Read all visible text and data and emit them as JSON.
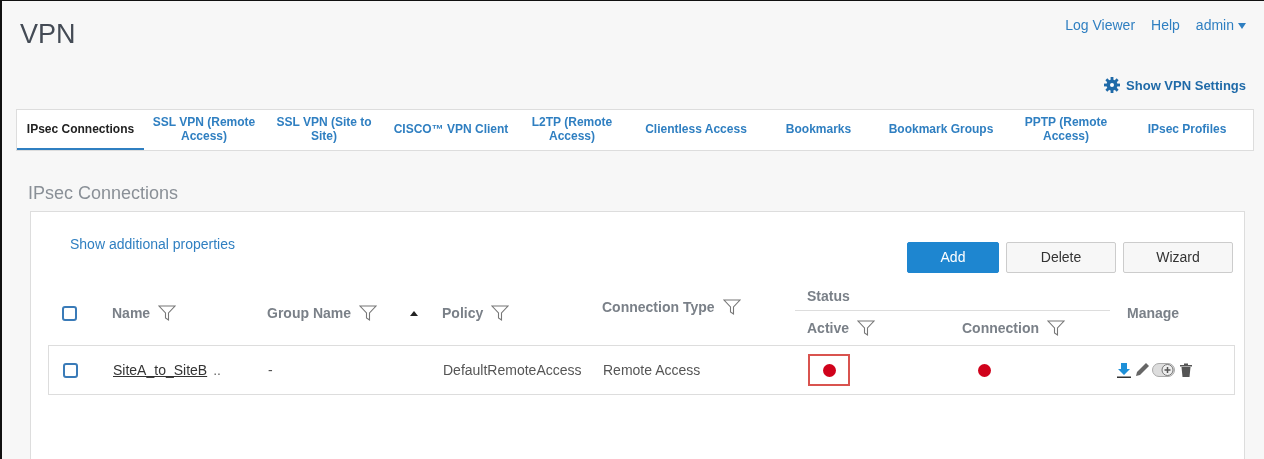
{
  "page_title": "VPN",
  "top_links": [
    {
      "label": "Log Viewer",
      "kind": "link"
    },
    {
      "label": "Help",
      "kind": "link"
    },
    {
      "label": "admin",
      "kind": "menu"
    }
  ],
  "settings_link": "Show VPN Settings",
  "tabs": [
    {
      "label": "IPsec Connections",
      "selected": true
    },
    {
      "label": "SSL VPN (Remote Access)",
      "selected": false
    },
    {
      "label": "SSL VPN (Site to Site)",
      "selected": false
    },
    {
      "label": "CISCO™ VPN Client",
      "selected": false
    },
    {
      "label": "L2TP (Remote Access)",
      "selected": false
    },
    {
      "label": "Clientless Access",
      "selected": false
    },
    {
      "label": "Bookmarks",
      "selected": false
    },
    {
      "label": "Bookmark Groups",
      "selected": false
    },
    {
      "label": "PPTP (Remote Access)",
      "selected": false
    },
    {
      "label": "IPsec Profiles",
      "selected": false
    }
  ],
  "section_title": "IPsec Connections",
  "properties_link": "Show additional properties",
  "buttons": [
    {
      "label": "Add",
      "kind": "primary"
    },
    {
      "label": "Delete",
      "kind": "plain"
    },
    {
      "label": "Wizard",
      "kind": "plain"
    }
  ],
  "table": {
    "select_all_checked": false,
    "columns": {
      "name": "Name",
      "group_name": "Group Name",
      "policy": "Policy",
      "connection_type": "Connection Type",
      "status": "Status",
      "active": "Active",
      "connection": "Connection",
      "manage": "Manage"
    },
    "rows": [
      {
        "checked": false,
        "name": "SiteA_to_SiteB",
        "name_more": "..",
        "group_name": "-",
        "policy": "DefaultRemoteAccess",
        "connection_type": "Remote Access",
        "active": {
          "color": "#d0021b",
          "highlighted": true
        },
        "connection": {
          "color": "#d0021b",
          "highlighted": false
        }
      }
    ]
  }
}
